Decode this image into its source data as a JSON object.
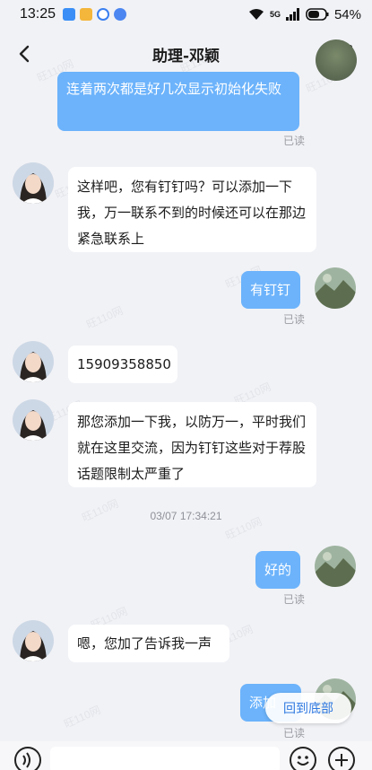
{
  "status_bar": {
    "time": "13:25",
    "network": "5G",
    "battery": "54%",
    "app_icons": [
      "blue-app-icon",
      "yellow-app-icon",
      "c-app-icon",
      "compass-app-icon"
    ]
  },
  "header": {
    "title": "助理-邓颖"
  },
  "messages": [
    {
      "side": "out",
      "text": "连着两次都是好几次显示初始化失败",
      "read": "已读"
    },
    {
      "side": "in",
      "text": "这样吧，您有钉钉吗？可以添加一下我，万一联系不到的时候还可以在那边紧急联系上"
    },
    {
      "side": "out",
      "text": "有钉钉",
      "read": "已读"
    },
    {
      "side": "in",
      "text": "15909358850"
    },
    {
      "side": "in",
      "text": "那您添加一下我，以防万一，平时我们就在这里交流，因为钉钉这些对于荐股话题限制太严重了"
    },
    {
      "side": "out",
      "text": "好的",
      "read": "已读"
    },
    {
      "side": "in",
      "text": "嗯，您加了告诉我一声"
    },
    {
      "side": "out",
      "text": "添加",
      "read": "已读"
    }
  ],
  "timestamp": "03/07 17:34:21",
  "scroll_bottom_button": "回到底部",
  "watermark": "旺110网",
  "colors": {
    "outgoing_bubble": "#6cb3fb",
    "incoming_bubble": "#ffffff",
    "background": "#f1f2f6",
    "accent": "#2f78e0"
  }
}
